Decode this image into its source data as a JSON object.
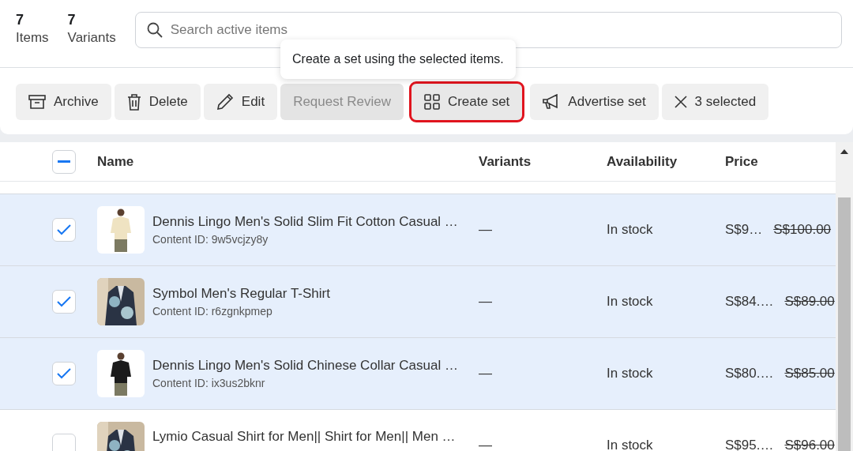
{
  "stats": [
    {
      "count": "7",
      "label": "Items"
    },
    {
      "count": "7",
      "label": "Variants"
    }
  ],
  "search": {
    "placeholder": "Search active items"
  },
  "tooltip": "Create a set using the selected items.",
  "actions": [
    {
      "kind": "archive",
      "label": "Archive",
      "disabled": false,
      "highlighted": false
    },
    {
      "kind": "delete",
      "label": "Delete",
      "disabled": false,
      "highlighted": false
    },
    {
      "kind": "edit",
      "label": "Edit",
      "disabled": false,
      "highlighted": false
    },
    {
      "kind": "plain",
      "label": "Request Review",
      "disabled": true,
      "highlighted": false
    },
    {
      "kind": "grid",
      "label": "Create set",
      "disabled": false,
      "highlighted": true
    },
    {
      "kind": "megaphone",
      "label": "Advertise set",
      "disabled": false,
      "highlighted": false
    },
    {
      "kind": "close",
      "label": "3 selected",
      "disabled": false,
      "highlighted": false
    }
  ],
  "table": {
    "select_all": {
      "indeterminate": true
    },
    "columns": [
      "Name",
      "Variants",
      "Availability",
      "Price"
    ],
    "rows": [
      {
        "name": "Dennis Lingo Men's Solid Slim Fit Cotton Casual …",
        "content_id": "Content ID: 9w5vcjzy8y",
        "variants": "—",
        "availability": "In stock",
        "price": "S$9…",
        "old_price": "S$100.00",
        "selected": true
      },
      {
        "name": "Symbol Men's Regular T-Shirt",
        "content_id": "Content ID: r6zgnkpmep",
        "variants": "—",
        "availability": "In stock",
        "price": "S$84.…",
        "old_price": "S$89.00",
        "selected": true
      },
      {
        "name": "Dennis Lingo Men's Solid Chinese Collar Casual …",
        "content_id": "Content ID: ix3us2bknr",
        "variants": "—",
        "availability": "In stock",
        "price": "S$80.…",
        "old_price": "S$85.00",
        "selected": true
      },
      {
        "name": "Lymio Casual Shirt for Men|| Shirt for Men|| Men …",
        "variants": "—",
        "availability": "In stock",
        "price": "S$95.…",
        "old_price": "S$96.00",
        "selected": false
      }
    ]
  }
}
